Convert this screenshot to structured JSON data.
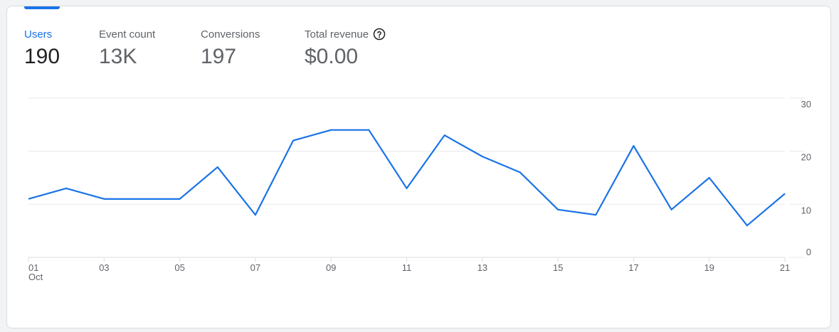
{
  "metrics": [
    {
      "label": "Users",
      "value": "190"
    },
    {
      "label": "Event count",
      "value": "13K"
    },
    {
      "label": "Conversions",
      "value": "197"
    },
    {
      "label": "Total revenue",
      "value": "$0.00"
    }
  ],
  "help_icon": "question-circle-icon",
  "colors": {
    "accent": "#1a73e8",
    "line": "#1a73e8",
    "grid": "#e8eaed",
    "axis_text": "#5f6368"
  },
  "chart_data": {
    "type": "line",
    "x_tick_labels": [
      "01",
      "03",
      "05",
      "07",
      "09",
      "11",
      "13",
      "15",
      "17",
      "19",
      "21"
    ],
    "x_month_label": "Oct",
    "y_tick_labels": [
      "0",
      "10",
      "20",
      "30"
    ],
    "ylim": [
      0,
      30
    ],
    "grid": true,
    "x": [
      1,
      2,
      3,
      4,
      5,
      6,
      7,
      8,
      9,
      10,
      11,
      12,
      13,
      14,
      15,
      16,
      17,
      18,
      19,
      20,
      21
    ],
    "series": [
      {
        "values": [
          11,
          13,
          11,
          11,
          11,
          17,
          8,
          22,
          24,
          24,
          13,
          23,
          19,
          16,
          9,
          8,
          21,
          9,
          15,
          6,
          12
        ]
      }
    ]
  }
}
